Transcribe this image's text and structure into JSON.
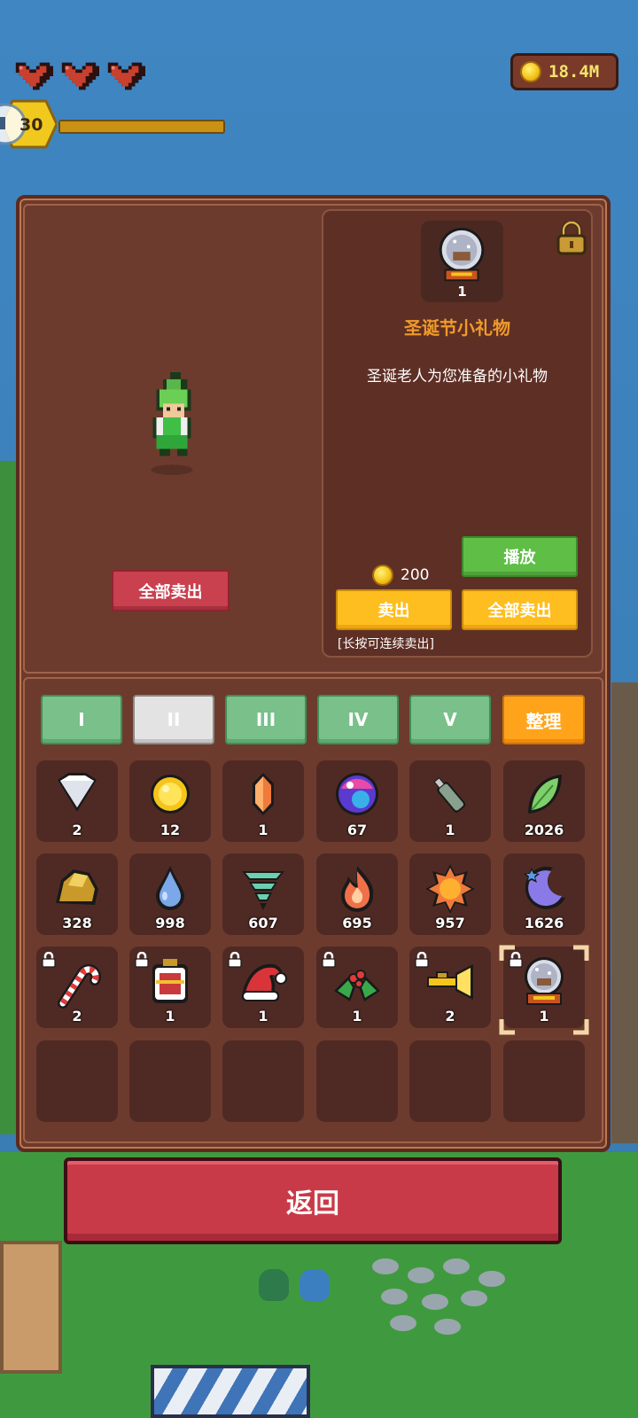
{
  "hud": {
    "hearts": 3,
    "gold": "18.4M",
    "level": "30",
    "xp_progress": 1.0
  },
  "hero_panel": {
    "sell_all_label": "全部卖出"
  },
  "detail": {
    "icon_name": "snow-globe-icon",
    "icon_count": "1",
    "title": "圣诞节小礼物",
    "description": "圣诞老人为您准备的小礼物",
    "price": "200",
    "play_label": "播放",
    "sell_label": "卖出",
    "sell_all_label": "全部卖出",
    "hint": "[长按可连续卖出]",
    "locked": true
  },
  "tabs": [
    {
      "label": "I",
      "active": false
    },
    {
      "label": "II",
      "active": true
    },
    {
      "label": "III",
      "active": false
    },
    {
      "label": "IV",
      "active": false
    },
    {
      "label": "V",
      "active": false
    }
  ],
  "sort_label": "整理",
  "items": [
    {
      "icon": "diamond-icon",
      "count": "2",
      "locked": false
    },
    {
      "icon": "gold-coin-icon",
      "count": "12",
      "locked": false
    },
    {
      "icon": "orange-crystal-icon",
      "count": "1",
      "locked": false
    },
    {
      "icon": "rainbow-orb-icon",
      "count": "67",
      "locked": false
    },
    {
      "icon": "bottle-icon",
      "count": "1",
      "locked": false
    },
    {
      "icon": "leaf-icon",
      "count": "2026",
      "locked": false
    },
    {
      "icon": "gold-ore-icon",
      "count": "328",
      "locked": false
    },
    {
      "icon": "water-drop-icon",
      "count": "998",
      "locked": false
    },
    {
      "icon": "tornado-icon",
      "count": "607",
      "locked": false
    },
    {
      "icon": "fire-icon",
      "count": "695",
      "locked": false
    },
    {
      "icon": "sun-icon",
      "count": "957",
      "locked": false
    },
    {
      "icon": "moon-icon",
      "count": "1626",
      "locked": false
    },
    {
      "icon": "candy-cane-icon",
      "count": "2",
      "locked": true
    },
    {
      "icon": "lantern-icon",
      "count": "1",
      "locked": true
    },
    {
      "icon": "santa-hat-icon",
      "count": "1",
      "locked": true
    },
    {
      "icon": "holly-icon",
      "count": "1",
      "locked": true
    },
    {
      "icon": "trumpet-icon",
      "count": "2",
      "locked": true
    },
    {
      "icon": "snow-globe-icon",
      "count": "1",
      "locked": true,
      "selected": true
    }
  ],
  "empty_slots": 6,
  "back_label": "返回",
  "colors": {
    "panel": "#6e3a2c",
    "slot": "#4f2a24",
    "title_orange": "#f09a2a",
    "tab_green": "#79c08a",
    "button_yellow": "#ffbe1f",
    "button_red": "#c9404e",
    "button_green": "#5fbe46"
  }
}
